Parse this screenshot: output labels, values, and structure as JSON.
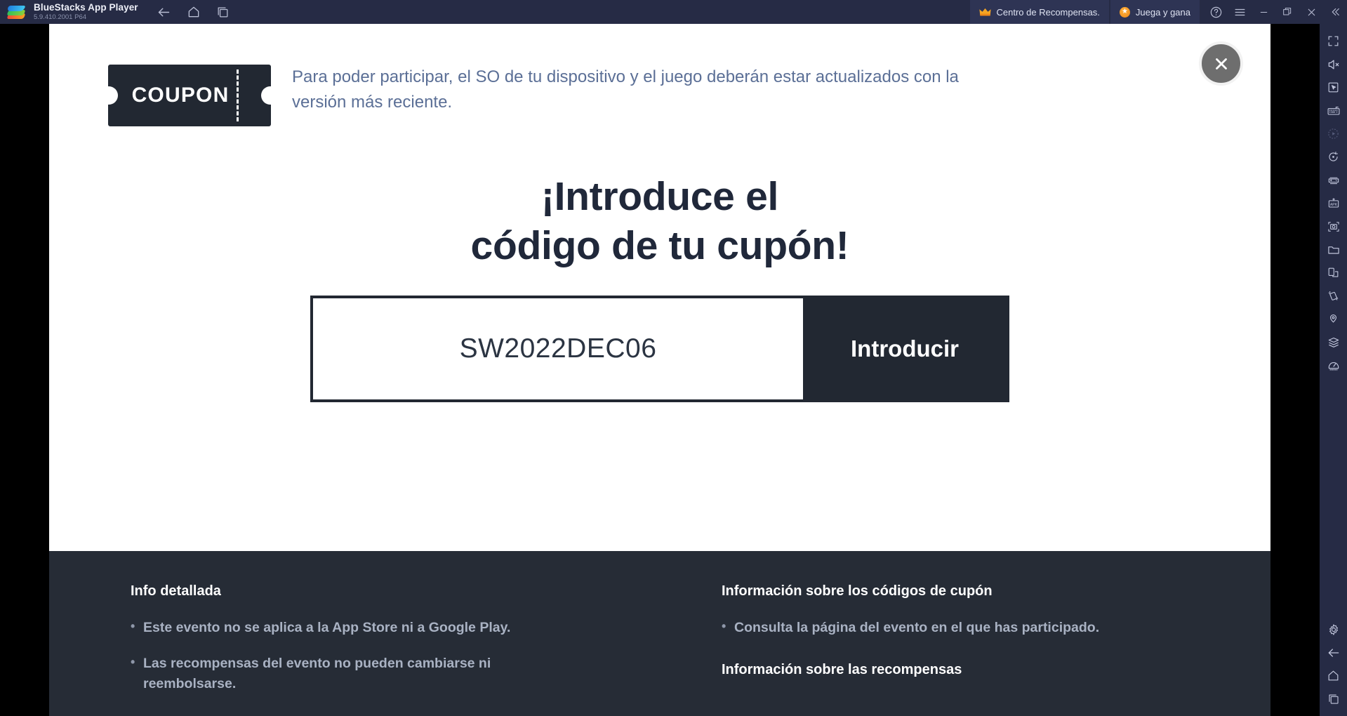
{
  "titlebar": {
    "app_title": "BlueStacks App Player",
    "version": "5.9.410.2001  P64",
    "logo_icon": "bluestacks-logo",
    "nav": [
      {
        "name": "back-icon",
        "label": "Back"
      },
      {
        "name": "home-icon",
        "label": "Home"
      },
      {
        "name": "recents-icon",
        "label": "Recent apps"
      }
    ],
    "pills": [
      {
        "name": "rewards-center",
        "icon": "crown-icon",
        "label": "Centro de Recompensas."
      },
      {
        "name": "play-and-earn",
        "icon": "star-badge-icon",
        "label": "Juega y gana"
      }
    ],
    "window_buttons": [
      {
        "name": "help-icon",
        "label": "?"
      },
      {
        "name": "menu-icon",
        "label": "Menu"
      },
      {
        "name": "minimize-icon",
        "label": "Minimize"
      },
      {
        "name": "maximize-icon",
        "label": "Maximize"
      },
      {
        "name": "close-icon",
        "label": "Close"
      },
      {
        "name": "collapse-icon",
        "label": "Collapse"
      }
    ]
  },
  "modal": {
    "close_button_label": "Cerrar",
    "coupon_badge_text": "COUPON",
    "notice": "Para poder participar, el SO de tu dispositivo y el juego deberán estar actualizados con la versión más reciente.",
    "headline_line1": "¡Introduce el",
    "headline_line2": "código de tu cupón!",
    "code_input_value": "SW2022DEC06",
    "code_input_placeholder": "SW2022DEC06",
    "submit_label": "Introducir"
  },
  "footer": {
    "left": {
      "title": "Info detallada",
      "items": [
        "Este evento no se aplica a la App Store ni a Google Play.",
        "Las recompensas del evento no pueden cambiarse ni reembolsarse."
      ]
    },
    "right": {
      "title": "Información sobre los códigos de cupón",
      "items": [
        "Consulta la página del evento en el que has participado."
      ],
      "second_title": "Información sobre las recompensas"
    }
  },
  "sidebar": {
    "items": [
      {
        "name": "fullscreen-icon",
        "label": "Pantalla completa"
      },
      {
        "name": "mute-icon",
        "label": "Silenciar"
      },
      {
        "name": "cursor-icon",
        "label": "Control del cursor"
      },
      {
        "name": "keyboard-icon",
        "label": "Controles de teclado"
      },
      {
        "name": "record-icon",
        "label": "Grabar",
        "state": "disabled"
      },
      {
        "name": "rotate-icon",
        "label": "Rotar"
      },
      {
        "name": "gamepad-icon",
        "label": "Gamepad"
      },
      {
        "name": "install-apk-icon",
        "label": "Instalar APK"
      },
      {
        "name": "screenshot-icon",
        "label": "Captura de pantalla"
      },
      {
        "name": "media-folder-icon",
        "label": "Gestor multimedia"
      },
      {
        "name": "multi-instance-icon",
        "label": "Multi-instancia"
      },
      {
        "name": "shake-icon",
        "label": "Agitar"
      },
      {
        "name": "location-icon",
        "label": "Ubicación"
      },
      {
        "name": "macros-icon",
        "label": "Macros"
      },
      {
        "name": "performance-icon",
        "label": "Rendimiento"
      }
    ],
    "bottom_items": [
      {
        "name": "settings-gear-icon",
        "label": "Ajustes"
      },
      {
        "name": "back-icon",
        "label": "Atrás"
      },
      {
        "name": "home-icon",
        "label": "Inicio"
      },
      {
        "name": "recents-icon",
        "label": "Recientes"
      }
    ]
  },
  "colors": {
    "titlebar_bg": "#262b45",
    "pill_bg": "#2e3454",
    "accent_orange": "#ef8816",
    "modal_dark": "#222832",
    "footer_bg": "#262c36",
    "notice_text": "#5b6f96"
  }
}
